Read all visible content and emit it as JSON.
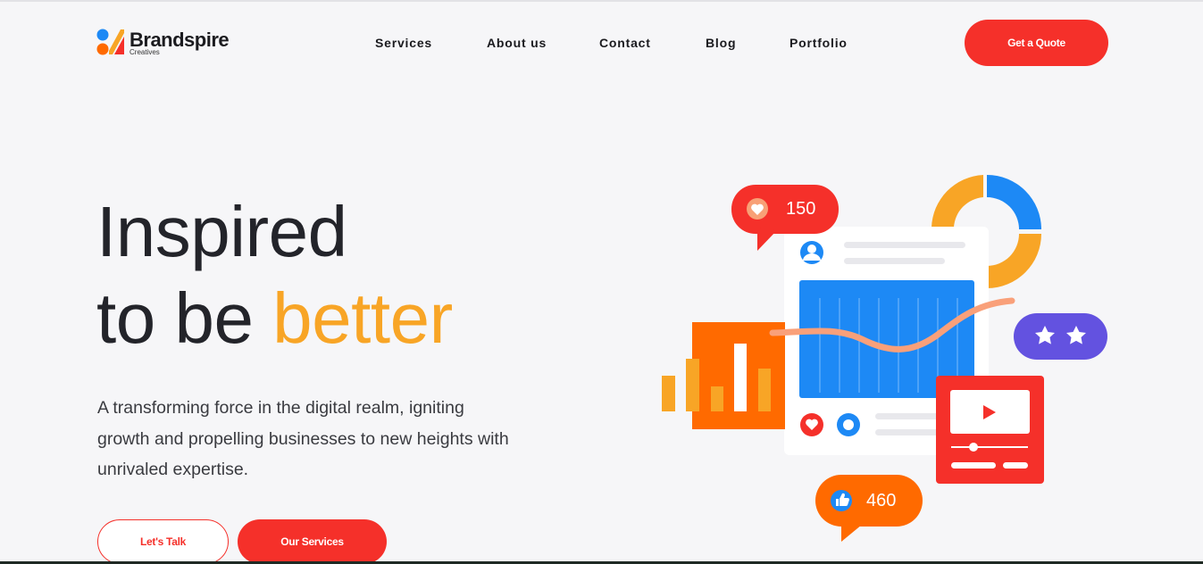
{
  "brand": {
    "name": "Brandspire",
    "tagline": "Creatives"
  },
  "nav": {
    "items": [
      "Services",
      "About us",
      "Contact",
      "Blog",
      "Portfolio"
    ],
    "cta_label": "Get a Quote"
  },
  "hero": {
    "line1": "Inspired",
    "line2_prefix": "to be",
    "line2_accent": "better",
    "description": "A transforming force in the digital realm, igniting growth and propelling businesses to new heights with unrivaled expertise.",
    "primary_label": "Let's Talk",
    "secondary_label": "Our Services"
  },
  "illustration": {
    "likes_count": "150",
    "thumbs_count": "460",
    "rating_stars": 2
  },
  "colors": {
    "accent_red": "#f5302a",
    "accent_orange": "#f8a526",
    "blue": "#1d89f5",
    "purple": "#6352e0"
  }
}
